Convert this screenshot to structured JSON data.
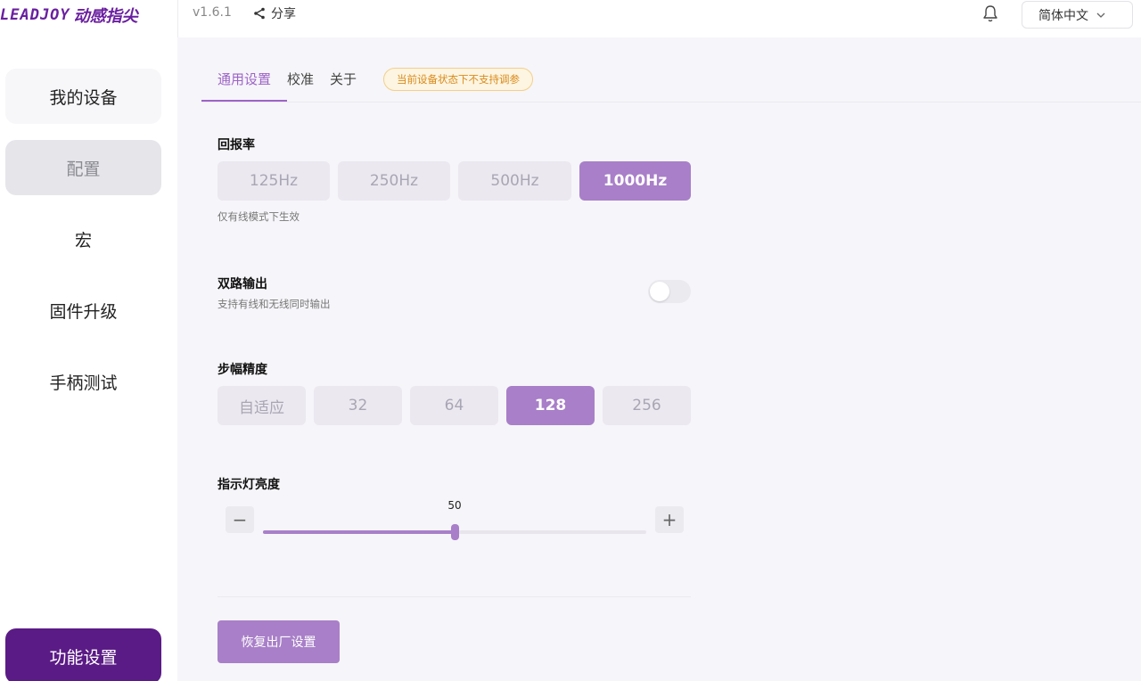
{
  "app": {
    "logo_en": "LEADJOY",
    "logo_cn": "动感指尖",
    "version": "v1.6.1",
    "share_label": "分享",
    "language": "简体中文"
  },
  "sidebar": {
    "items": [
      {
        "label": "我的设备"
      },
      {
        "label": "配置"
      },
      {
        "label": "宏"
      },
      {
        "label": "固件升级"
      },
      {
        "label": "手柄测试"
      }
    ],
    "bottom_label": "功能设置"
  },
  "tabs": [
    {
      "label": "通用设置",
      "active": true
    },
    {
      "label": "校准"
    },
    {
      "label": "关于"
    }
  ],
  "warning_badge": "当前设备状态下不支持调参",
  "report_rate": {
    "title": "回报率",
    "desc": "仅有线模式下生效",
    "options": [
      "125Hz",
      "250Hz",
      "500Hz",
      "1000Hz"
    ],
    "selected": "1000Hz"
  },
  "dual_output": {
    "title": "双路输出",
    "desc": "支持有线和无线同时输出",
    "enabled": false
  },
  "step_precision": {
    "title": "步幅精度",
    "options": [
      "自适应",
      "32",
      "64",
      "128",
      "256"
    ],
    "selected": "128"
  },
  "led_brightness": {
    "title": "指示灯亮度",
    "value": "50",
    "minus": "−",
    "plus": "+"
  },
  "reset_label": "恢复出厂设置",
  "colors": {
    "accent": "#a87fc8",
    "brand": "#5b1b86",
    "warning": "#d98a1c"
  }
}
